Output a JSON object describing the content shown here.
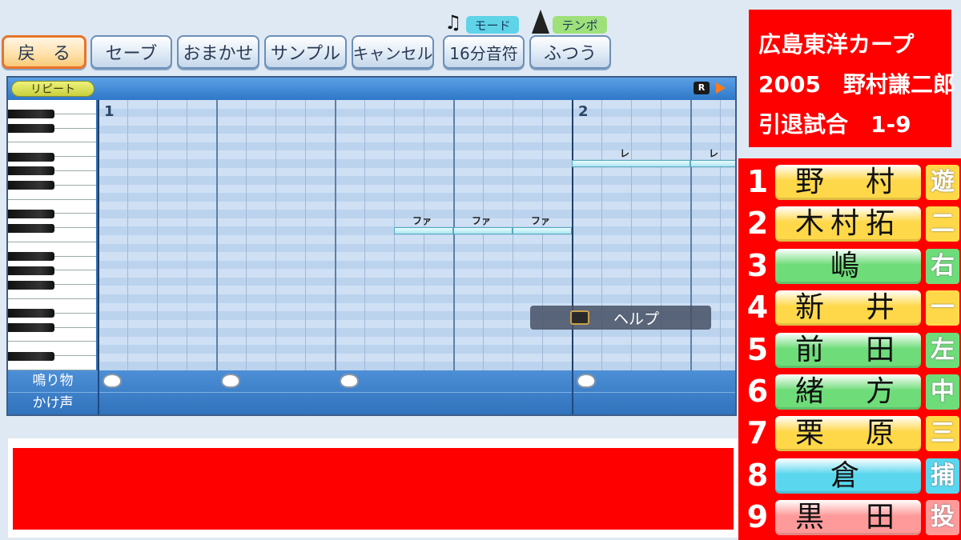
{
  "toolbar": {
    "back_label": "戻　る",
    "save_label": "セーブ",
    "auto_label": "おまかせ",
    "sample_label": "サンプル",
    "cancel_label": "キャンセル",
    "mode_tag": "モード",
    "tempo_tag": "テンポ",
    "mode_value": "16分音符",
    "tempo_value": "ふつう"
  },
  "editor": {
    "repeat_label": "リピート",
    "measure_numbers": [
      "1",
      "2"
    ],
    "corner_badge": "R",
    "notes": [
      {
        "label": "ファ",
        "row": 15,
        "start": 10,
        "length": 2
      },
      {
        "label": "ファ",
        "row": 15,
        "start": 12,
        "length": 2
      },
      {
        "label": "ファ",
        "row": 15,
        "start": 14,
        "length": 2
      },
      {
        "label": "レ",
        "row": 7,
        "start": 16,
        "length": 4
      },
      {
        "label": "レ",
        "row": 7,
        "start": 20,
        "length": 2
      }
    ],
    "help_label": "ヘルプ",
    "percussion_label": "鳴り物",
    "voice_label": "かけ声",
    "drum_steps": [
      0,
      4,
      8,
      16
    ]
  },
  "title_panel": {
    "line1": "広島東洋カープ",
    "line2": "2005　野村謙二郎",
    "line3": "引退試合　1-9"
  },
  "lineup": [
    {
      "order": "1",
      "name": "野　村",
      "position": "遊",
      "color": "#ffd84a"
    },
    {
      "order": "2",
      "name": "木村拓",
      "position": "二",
      "color": "#ffd84a"
    },
    {
      "order": "3",
      "name": "嶋",
      "position": "右",
      "color": "#6fdc7a"
    },
    {
      "order": "4",
      "name": "新　井",
      "position": "一",
      "color": "#ffd84a"
    },
    {
      "order": "5",
      "name": "前　田",
      "position": "左",
      "color": "#6fdc7a"
    },
    {
      "order": "6",
      "name": "緒　方",
      "position": "中",
      "color": "#6fdc7a"
    },
    {
      "order": "7",
      "name": "栗　原",
      "position": "三",
      "color": "#ffd84a"
    },
    {
      "order": "8",
      "name": "倉",
      "position": "捕",
      "color": "#5ad6ee"
    },
    {
      "order": "9",
      "name": "黒　田",
      "position": "投",
      "color": "#ff9a9a"
    }
  ],
  "colors": {
    "accent_red": "#ff0000",
    "active_border": "#e8742a"
  }
}
